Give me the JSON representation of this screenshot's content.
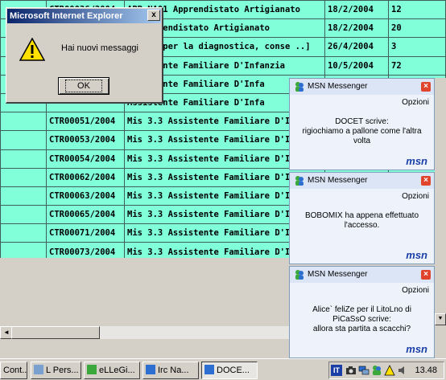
{
  "table": {
    "rows": [
      [
        "",
        "CTR00036/2004",
        "APP NA01 Apprendistato Artigianato",
        "18/2/2004",
        "12"
      ],
      [
        "",
        "",
        "02 Apprendistato Artigianato",
        "18/2/2004",
        "20"
      ],
      [
        "",
        "",
        "ecnico per la diagnostica, conse ..]",
        "26/4/2004",
        "3"
      ],
      [
        "",
        "",
        "Assistente Familiare D'Infanzia",
        "10/5/2004",
        "72"
      ],
      [
        "",
        "",
        "Assistente Familiare D'Infa",
        "",
        ""
      ],
      [
        "",
        "",
        "Assistente Familiare D'Infa",
        "",
        ""
      ],
      [
        "",
        "CTR00051/2004",
        "Mis 3.3 Assistente Familiare D'Infa",
        "",
        ""
      ],
      [
        "",
        "CTR00053/2004",
        "Mis 3.3 Assistente Familiare D'Infa",
        "",
        ""
      ],
      [
        "",
        "CTR00054/2004",
        "Mis 3.3 Assistente Familiare D'Infa",
        "",
        ""
      ],
      [
        "",
        "CTR00062/2004",
        "Mis 3.3 Assistente Familiare D'Infa",
        "",
        ""
      ],
      [
        "",
        "CTR00063/2004",
        "Mis 3.3 Assistente Familiare D'Infa",
        "",
        ""
      ],
      [
        "",
        "CTR00065/2004",
        "Mis 3.3 Assistente Familiare D'Infa",
        "",
        ""
      ],
      [
        "",
        "CTR00071/2004",
        "Mis 3.3 Assistente Familiare D'Infa",
        "",
        ""
      ],
      [
        "",
        "CTR00073/2004",
        "Mis 3.3 Assistente Familiare D'Infa",
        "",
        ""
      ]
    ]
  },
  "dialog": {
    "title": "Microsoft Internet Explorer",
    "close": "x",
    "message": "Hai nuovi messaggi",
    "ok_label": "OK",
    "icon": "warning-icon"
  },
  "toasts": [
    {
      "title": "MSN Messenger",
      "options": "Opzioni",
      "line1": "DOCET scrive:",
      "line2": "rigiochiamo a pallone come l'altra",
      "line3": "volta",
      "logo": "msn"
    },
    {
      "title": "MSN Messenger",
      "options": "Opzioni",
      "line1": "BOBOMIX ha appena effettuato",
      "line2": "l'accesso.",
      "line3": "",
      "logo": "msn"
    },
    {
      "title": "MSN Messenger",
      "options": "Opzioni",
      "line1": "Alice` feliZe per il LitoLno di",
      "line2": "PiCaSsO scrive:",
      "line3": "allora sta partita a scacchi?",
      "logo": "msn"
    }
  ],
  "scrollbar": {
    "left_arrow": "◄",
    "right_arrow": "►",
    "up_arrow": "▲",
    "down_arrow": "▼"
  },
  "taskbar": {
    "items": [
      {
        "label": "Cont..."
      },
      {
        "label": "L Pers..."
      },
      {
        "label": "eLLeGi..."
      },
      {
        "label": "Irc Na..."
      },
      {
        "label": "DOCE..."
      }
    ],
    "lang": "IT",
    "clock": "13.48"
  },
  "colors": {
    "table_bg": "#80ffd9",
    "titlebar": "#0a246a",
    "msn_blue": "#1a3fa6"
  }
}
